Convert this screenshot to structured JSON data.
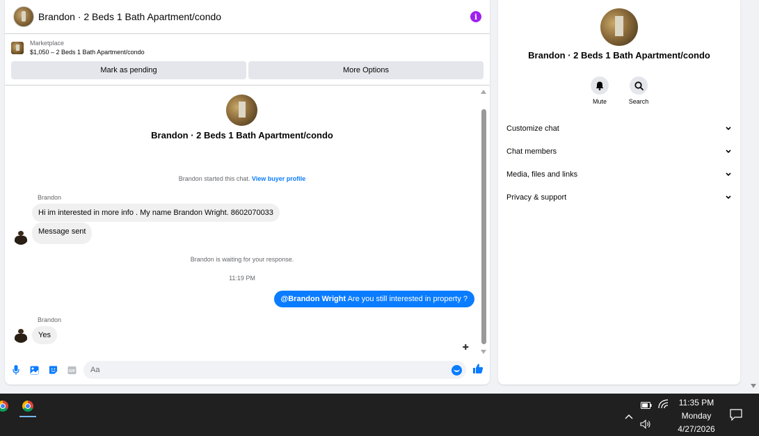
{
  "chat": {
    "title": "Brandon · 2 Beds 1 Bath Apartment/condo",
    "listing": {
      "source": "Marketplace",
      "price_title": "$1,050 – 2 Beds 1 Bath Apartment/condo"
    },
    "actions": {
      "mark_pending": "Mark as pending",
      "more_options": "More Options"
    },
    "conversation_title": "Brandon · 2 Beds 1 Bath Apartment/condo",
    "started_text": "Brandon started this chat.",
    "view_profile": "View buyer profile",
    "messages": [
      {
        "sender": "Brandon",
        "text": "Hi im interested in more info . My name Brandon Wright. 8602070033"
      },
      {
        "text": "Message sent"
      }
    ],
    "waiting_text": "Brandon is waiting for your response.",
    "timestamp": "11:19 PM",
    "outgoing": {
      "mention": "@Brandon Wright",
      "text": " Are you still interested in property ?"
    },
    "reply": {
      "sender": "Brandon",
      "text": "Yes"
    },
    "composer": {
      "placeholder": "Aa"
    }
  },
  "info_panel": {
    "title": "Brandon · 2 Beds 1 Bath Apartment/condo",
    "mute_label": "Mute",
    "search_label": "Search",
    "menu": [
      "Customize chat",
      "Chat members",
      "Media, files and links",
      "Privacy & support"
    ]
  },
  "taskbar": {
    "time": "11:35 PM",
    "day": "Monday",
    "date": "4/27/2026"
  },
  "colors": {
    "accent": "#0a7cff",
    "info_icon": "#a020f0",
    "taskbar": "#202020"
  }
}
